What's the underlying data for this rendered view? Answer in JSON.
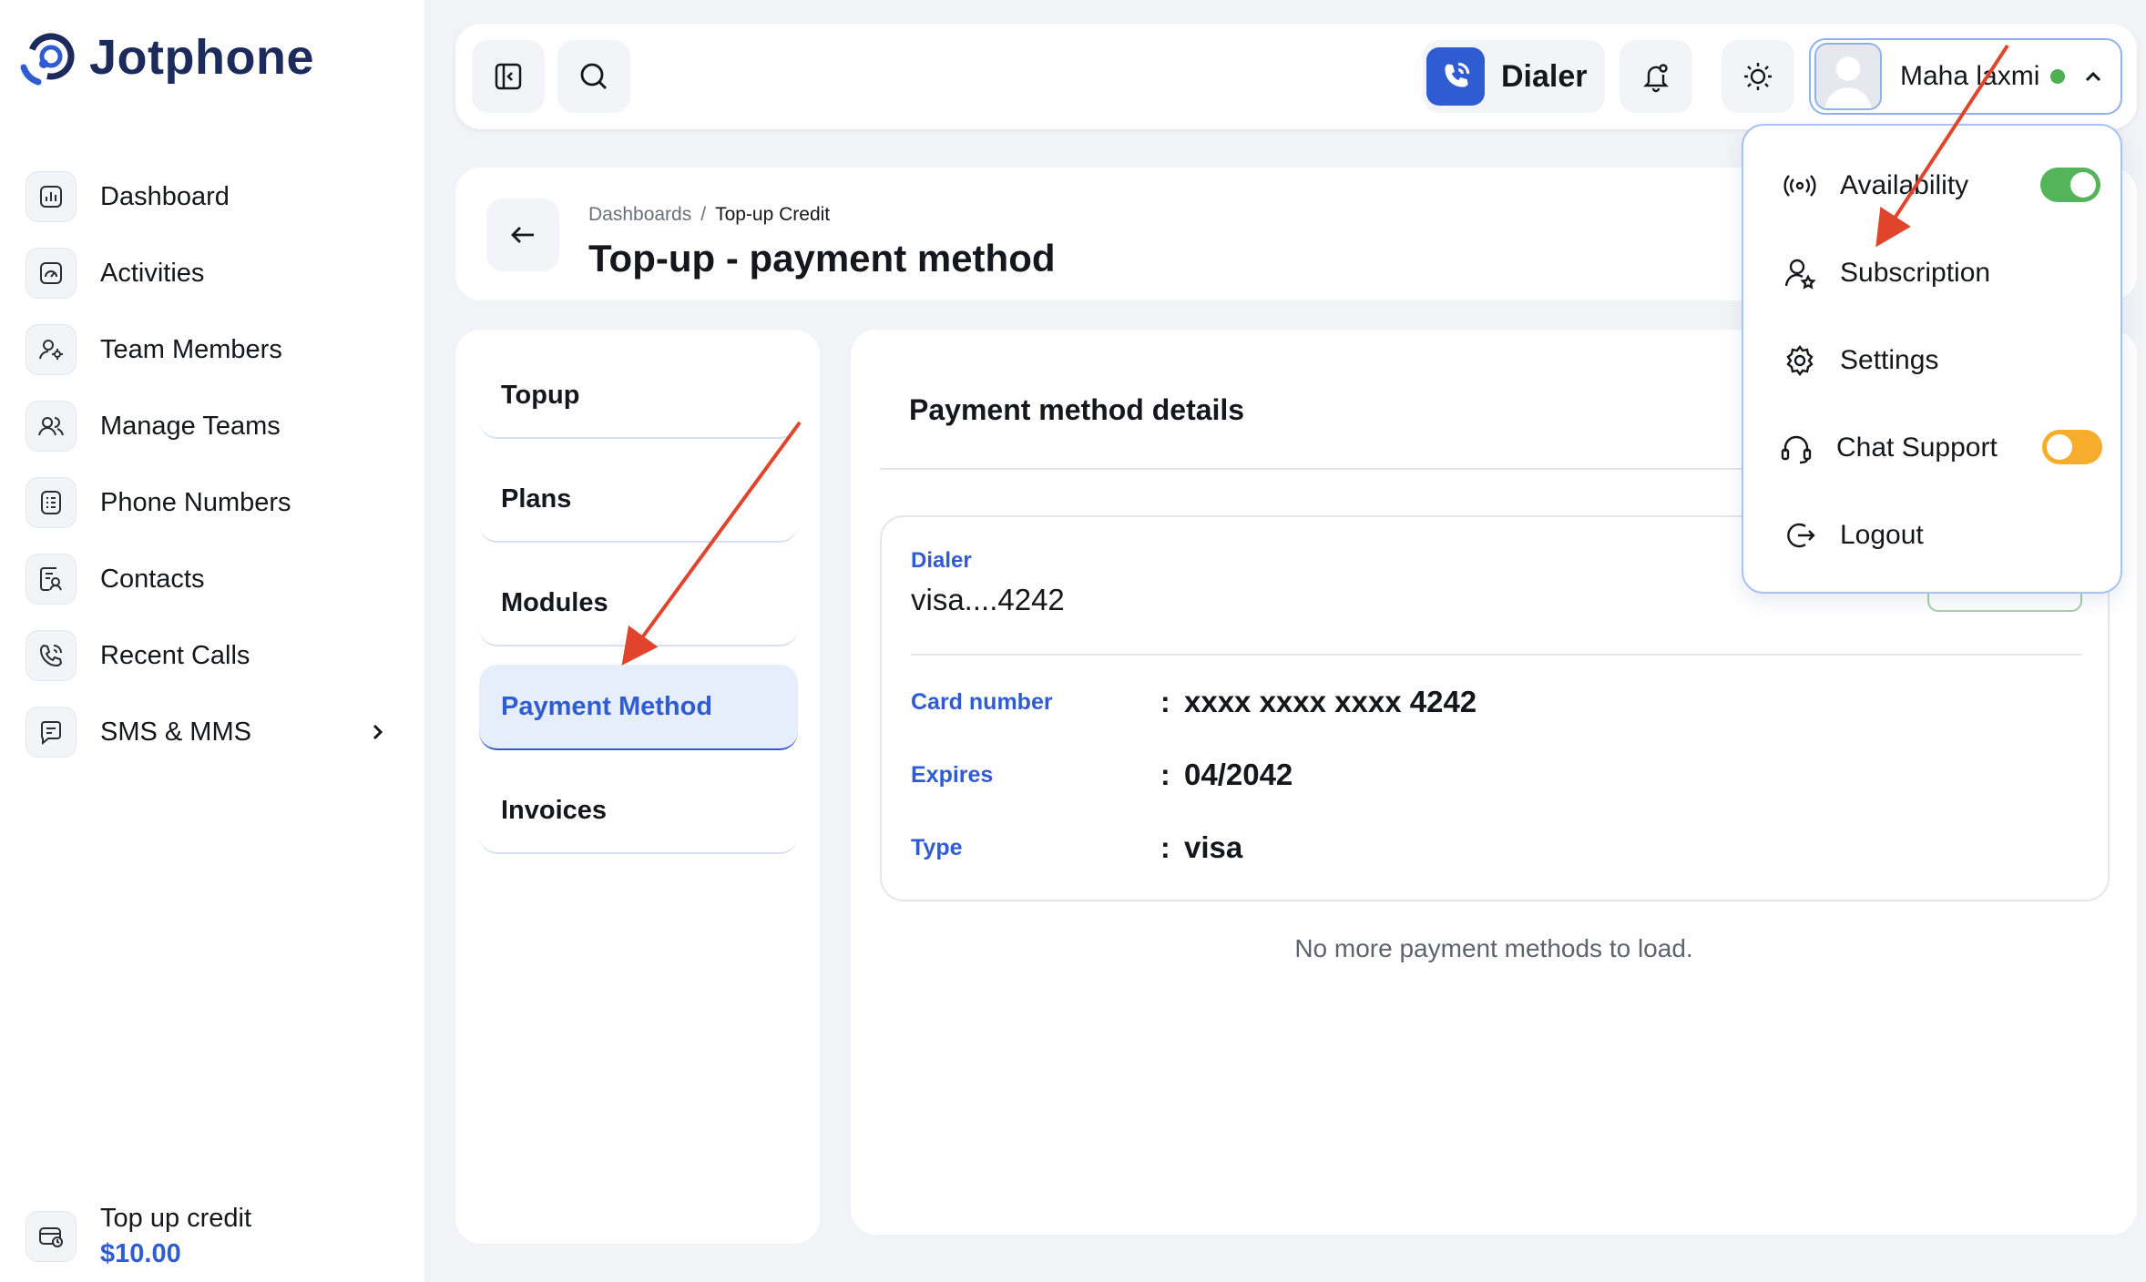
{
  "brand": {
    "name": "Jotphone",
    "color": "#1d2b5c",
    "accent": "#2f5bd3"
  },
  "sidebar": {
    "items": [
      {
        "label": "Dashboard",
        "icon": "chart-icon"
      },
      {
        "label": "Activities",
        "icon": "gauge-icon"
      },
      {
        "label": "Team Members",
        "icon": "user-gear-icon"
      },
      {
        "label": "Manage Teams",
        "icon": "users-icon"
      },
      {
        "label": "Phone Numbers",
        "icon": "phone-list-icon"
      },
      {
        "label": "Contacts",
        "icon": "contact-card-icon"
      },
      {
        "label": "Recent Calls",
        "icon": "phone-call-icon"
      },
      {
        "label": "SMS & MMS",
        "icon": "chat-icon"
      }
    ],
    "credit": {
      "label": "Top up credit",
      "amount": "$10.00"
    }
  },
  "topbar": {
    "dialer_label": "Dialer",
    "user_name": "Maha laxmi",
    "status_color": "#4cb050"
  },
  "page": {
    "breadcrumb": [
      "Dashboards",
      "Top-up Credit"
    ],
    "title": "Top-up - payment method"
  },
  "tabs": [
    "Topup",
    "Plans",
    "Modules",
    "Payment Method",
    "Invoices"
  ],
  "active_tab": "Payment Method",
  "payment": {
    "section_title": "Payment method details",
    "provider": "Dialer",
    "masked": "visa....4242",
    "rows": [
      {
        "key": "Card number",
        "value": "xxxx xxxx xxxx 4242"
      },
      {
        "key": "Expires",
        "value": "04/2042"
      },
      {
        "key": "Type",
        "value": "visa"
      }
    ],
    "footer": "No more payment methods to load."
  },
  "dropdown": {
    "items": [
      {
        "label": "Availability",
        "icon": "broadcast-icon",
        "toggle": "on"
      },
      {
        "label": "Subscription",
        "icon": "user-star-icon"
      },
      {
        "label": "Settings",
        "icon": "gear-icon"
      },
      {
        "label": "Chat Support",
        "icon": "headset-icon",
        "toggle": "off"
      },
      {
        "label": "Logout",
        "icon": "logout-icon"
      }
    ]
  }
}
